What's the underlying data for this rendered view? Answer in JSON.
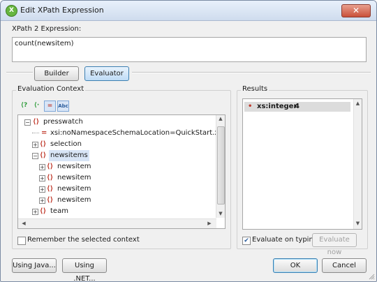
{
  "window": {
    "title": "Edit XPath Expression",
    "icon": "app-icon",
    "close_glyph": "✕"
  },
  "expression": {
    "label": "XPath 2 Expression:",
    "value": "count(newsitem)"
  },
  "mode_buttons": {
    "builder": "Builder",
    "evaluator": "Evaluator",
    "active": "evaluator"
  },
  "evaluation_context": {
    "title": "Evaluation Context",
    "toolbar": [
      {
        "icon": "xpath-root-icon",
        "glyph": "⟨?"
      },
      {
        "icon": "xpath-insert-icon",
        "glyph": "⟨·"
      },
      {
        "icon": "attribute-icon",
        "glyph": "="
      },
      {
        "icon": "text-node-icon",
        "glyph": "Abc"
      }
    ],
    "tree": {
      "root": "presswatch",
      "attribute": "xsi:noNamespaceSchemaLocation=QuickStart.xsd",
      "selection": "selection",
      "newsitems": "newsitems",
      "newsitem_children": [
        "newsitem",
        "newsitem",
        "newsitem",
        "newsitem"
      ],
      "team": "team"
    },
    "remember_label": "Remember the selected context",
    "remember_checked": false
  },
  "results": {
    "title": "Results",
    "rows": [
      {
        "type": "xs:integer",
        "value": "4"
      }
    ],
    "evaluate_on_typing_label": "Evaluate on typing",
    "evaluate_on_typing_checked": true,
    "evaluate_now_label": "Evaluate now"
  },
  "footer": {
    "using_java": "Using Java...",
    "using_net": "Using .NET...",
    "ok": "OK",
    "cancel": "Cancel"
  },
  "colors": {
    "accent": "#3c7fb1",
    "element_icon": "#c0392b",
    "selection": "#d8e5f6"
  }
}
